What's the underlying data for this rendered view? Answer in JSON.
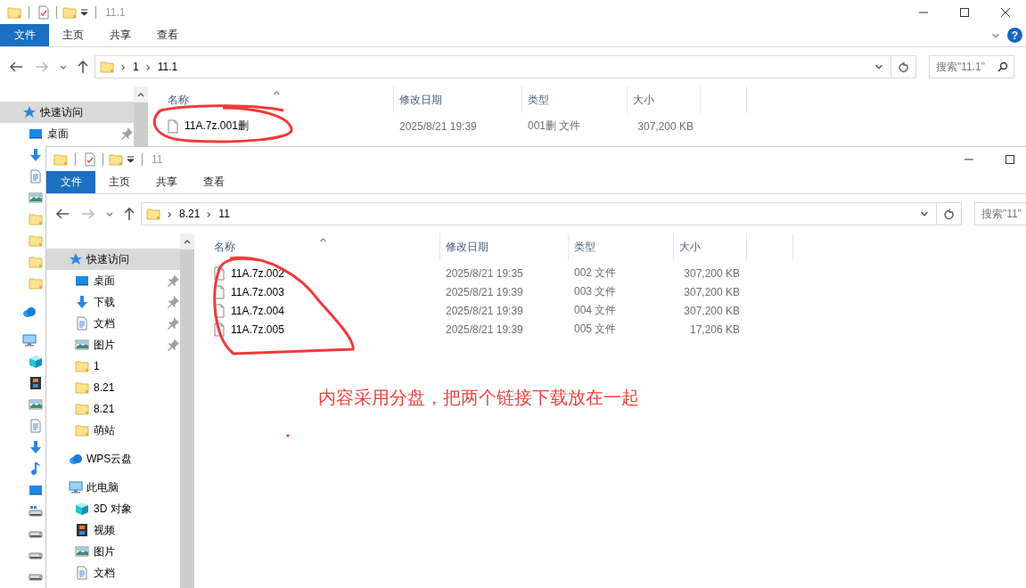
{
  "windows": [
    {
      "title": "11.1",
      "ribbon_tabs": [
        {
          "label": "文件",
          "kind": "file"
        },
        {
          "label": "主页",
          "kind": "tab"
        },
        {
          "label": "共享",
          "kind": "tab"
        },
        {
          "label": "查看",
          "kind": "tab"
        }
      ],
      "help": "?",
      "breadcrumb": [
        "1",
        "11.1"
      ],
      "search": {
        "placeholder": "搜索\"11.1\""
      },
      "columns": [
        "名称",
        "修改日期",
        "类型",
        "大小"
      ],
      "sidebar": [
        {
          "label": "快速访问",
          "kind": "star",
          "selected": true,
          "children": [
            {
              "label": "桌面",
              "kind": "desktop",
              "pinned": true
            },
            {
              "kind": "download"
            },
            {
              "kind": "document"
            },
            {
              "kind": "pictures"
            },
            {
              "kind": "folder"
            },
            {
              "kind": "folder"
            },
            {
              "kind": "folder"
            },
            {
              "kind": "folder"
            }
          ]
        },
        {
          "kind": "cloud",
          "selected": false
        },
        {
          "kind": "computer",
          "selected": false,
          "children": [
            {
              "kind": "cube"
            },
            {
              "kind": "film"
            },
            {
              "kind": "pictures"
            },
            {
              "kind": "document"
            },
            {
              "kind": "download"
            },
            {
              "kind": "music"
            },
            {
              "kind": "desktop"
            },
            {
              "kind": "netdrive"
            },
            {
              "kind": "drive"
            },
            {
              "kind": "drive"
            },
            {
              "kind": "drive"
            }
          ]
        }
      ],
      "files": [
        {
          "name": "11A.7z.001删",
          "date": "2025/8/21 19:39",
          "type": "001删 文件",
          "size": "307,200 KB"
        }
      ]
    },
    {
      "title": "11",
      "ribbon_tabs": [
        {
          "label": "文件",
          "kind": "file"
        },
        {
          "label": "主页",
          "kind": "tab"
        },
        {
          "label": "共享",
          "kind": "tab"
        },
        {
          "label": "查看",
          "kind": "tab"
        }
      ],
      "breadcrumb": [
        "8.21",
        "11"
      ],
      "search": {
        "placeholder": "搜索\"11\""
      },
      "columns": [
        "名称",
        "修改日期",
        "类型",
        "大小"
      ],
      "sidebar": [
        {
          "label": "快速访问",
          "kind": "star",
          "selected": true,
          "children": [
            {
              "label": "桌面",
              "kind": "desktop",
              "pinned": true
            },
            {
              "label": "下载",
              "kind": "download",
              "pinned": true
            },
            {
              "label": "文档",
              "kind": "document",
              "pinned": true
            },
            {
              "label": "图片",
              "kind": "pictures",
              "pinned": true
            },
            {
              "label": "1",
              "kind": "folder",
              "pinned": false
            },
            {
              "label": "8.21",
              "kind": "folder",
              "pinned": false
            },
            {
              "label": "8.21",
              "kind": "folder",
              "pinned": false
            },
            {
              "label": "萌站",
              "kind": "folder",
              "pinned": false
            }
          ]
        },
        {
          "label": "WPS云盘",
          "kind": "cloud",
          "selected": false
        },
        {
          "label": "此电脑",
          "kind": "computer",
          "selected": false,
          "children": [
            {
              "label": "3D 对象",
              "kind": "cube"
            },
            {
              "label": "视频",
              "kind": "film"
            },
            {
              "label": "图片",
              "kind": "pictures"
            },
            {
              "label": "文档",
              "kind": "document"
            }
          ]
        }
      ],
      "files": [
        {
          "name": "11A.7z.002",
          "date": "2025/8/21 19:35",
          "type": "002 文件",
          "size": "307,200 KB"
        },
        {
          "name": "11A.7z.003",
          "date": "2025/8/21 19:39",
          "type": "003 文件",
          "size": "307,200 KB"
        },
        {
          "name": "11A.7z.004",
          "date": "2025/8/21 19:39",
          "type": "004 文件",
          "size": "307,200 KB"
        },
        {
          "name": "11A.7z.005",
          "date": "2025/8/21 19:39",
          "type": "005 文件",
          "size": "17,206 KB"
        }
      ]
    }
  ],
  "annotation": {
    "note": "内容采用分盘，把两个链接下载放在一起"
  }
}
